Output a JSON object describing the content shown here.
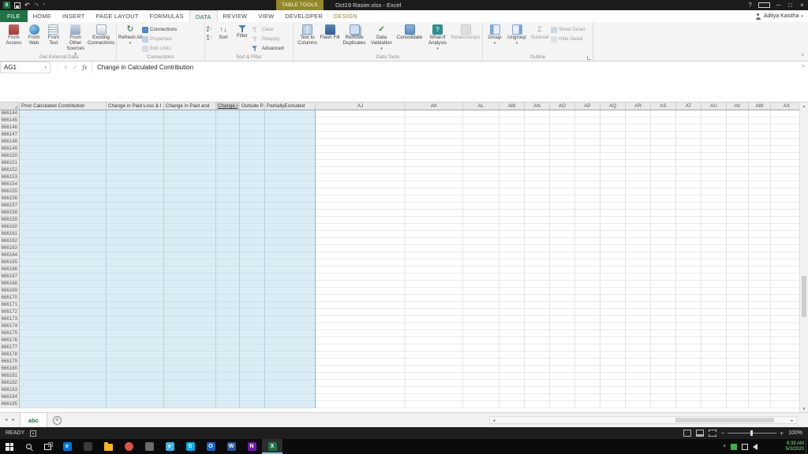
{
  "glyphs": {
    "undo": "↶",
    "redo": "↷",
    "qat_caret": "▾",
    "help": "?",
    "minimize": "─",
    "restore": "□",
    "close": "×",
    "refresh": "↻",
    "name_caret": "▾",
    "cancel": "×",
    "enter": "✓",
    "fx": "fx",
    "formula_collapse": "˅",
    "ribbon_collapse": "˄",
    "sort_large": "↑↓",
    "subtotal": "Σ",
    "whatif_q": "?",
    "nav_left": "◄",
    "nav_right": "►",
    "scroll_up": "▲",
    "scroll_down": "▼",
    "add_sheet": "+",
    "zoom_minus": "−",
    "zoom_plus": "+",
    "tray_chevron": "˄",
    "user_caret": "▾"
  },
  "colors": {
    "excel_green": "#217346",
    "table_tools_olive": "#93892a",
    "table_fill_blue": "#dbedf4"
  },
  "title_bar": {
    "contextual_label": "TABLE TOOLS",
    "title": "Oct19 Rasier.xlsx - Excel",
    "user": "Aditya Kaistha"
  },
  "tabs": {
    "active": "DATA",
    "items": [
      {
        "label": "FILE"
      },
      {
        "label": "HOME"
      },
      {
        "label": "INSERT"
      },
      {
        "label": "PAGE LAYOUT"
      },
      {
        "label": "FORMULAS"
      },
      {
        "label": "DATA"
      },
      {
        "label": "REVIEW"
      },
      {
        "label": "VIEW"
      },
      {
        "label": "DEVELOPER"
      },
      {
        "label": "DESIGN",
        "contextual": true
      }
    ]
  },
  "ribbon": {
    "groups": [
      {
        "name": "Get External Data",
        "buttons": [
          {
            "label": "From Access"
          },
          {
            "label": "From Web"
          },
          {
            "label": "From Text"
          },
          {
            "label": "From Other Sources"
          },
          {
            "label": "Existing Connections"
          }
        ]
      },
      {
        "name": "Connections",
        "large": [
          {
            "label": "Refresh All"
          }
        ],
        "small": [
          {
            "label": "Connections"
          },
          {
            "label": "Properties"
          },
          {
            "label": "Edit Links"
          }
        ]
      },
      {
        "name": "Sort & Filter",
        "large": [
          {
            "label": "Sort"
          },
          {
            "label": "Filter"
          }
        ],
        "small": [
          {
            "label": "Clear"
          },
          {
            "label": "Reapply"
          },
          {
            "label": "Advanced"
          }
        ]
      },
      {
        "name": "Data Tools",
        "buttons": [
          {
            "label": "Text to Columns"
          },
          {
            "label": "Flash Fill"
          },
          {
            "label": "Remove Duplicates"
          },
          {
            "label": "Data Validation"
          },
          {
            "label": "Consolidate"
          },
          {
            "label": "What-If Analysis"
          },
          {
            "label": "Relationships"
          }
        ]
      },
      {
        "name": "Outline",
        "large": [
          {
            "label": "Group"
          },
          {
            "label": "Ungroup"
          },
          {
            "label": "Subtotal"
          }
        ],
        "small": [
          {
            "label": "Show Detail"
          },
          {
            "label": "Hide Detail"
          }
        ]
      }
    ]
  },
  "formula_bar": {
    "name_box": "AG1",
    "formula": "Change in Calculated Contribution"
  },
  "grid": {
    "table_headers": [
      "Prior Calculated Contribution",
      "Change in Paid Loss & l",
      "Change in Paid and ",
      "Change i",
      "Outside P.",
      "PartiallyExcluded"
    ],
    "selected_header_index": 3,
    "letter_headers": [
      "AJ",
      "AK",
      "AL",
      "AM",
      "AN",
      "AO",
      "AP",
      "AQ",
      "AR",
      "AS",
      "AT",
      "AU",
      "AV",
      "AW",
      "AX"
    ],
    "rows": [
      666144,
      666145,
      666146,
      666147,
      666148,
      666149,
      666150,
      666151,
      666152,
      666153,
      666154,
      666155,
      666156,
      666157,
      666158,
      666159,
      666160,
      666161,
      666162,
      666163,
      666164,
      666165,
      666166,
      666167,
      666168,
      666169,
      666170,
      666171,
      666172,
      666173,
      666174,
      666175,
      666176,
      666177,
      666178,
      666179,
      666180,
      666181,
      666182,
      666183,
      666184,
      666185
    ]
  },
  "sheet_bar": {
    "tabs": [
      {
        "label": "abc",
        "active": true
      }
    ]
  },
  "status_bar": {
    "mode": "READY",
    "zoom_level": "100%"
  },
  "taskbar": {
    "apps": [
      {
        "name": "edge",
        "glyph": "e",
        "color": "#0078d7"
      },
      {
        "name": "mail",
        "glyph": "",
        "color": "#3a3a3a"
      },
      {
        "name": "file-explorer",
        "glyph": "",
        "color": "#f3b723",
        "folder": true
      },
      {
        "name": "chrome",
        "glyph": "",
        "color": "#de5246",
        "circle": true
      },
      {
        "name": "app-gray",
        "glyph": "",
        "color": "#6a6a6a"
      },
      {
        "name": "internet-explorer",
        "glyph": "e",
        "color": "#41b0e3"
      },
      {
        "name": "skype",
        "glyph": "S",
        "color": "#00aff0"
      },
      {
        "name": "outlook",
        "glyph": "O",
        "color": "#1565c0"
      },
      {
        "name": "word",
        "glyph": "W",
        "color": "#2b579a"
      },
      {
        "name": "onenote",
        "glyph": "N",
        "color": "#7719aa"
      },
      {
        "name": "excel",
        "glyph": "X",
        "color": "#217346",
        "active": true
      }
    ],
    "time": "6:39 AM",
    "date": "5/3/2020"
  }
}
